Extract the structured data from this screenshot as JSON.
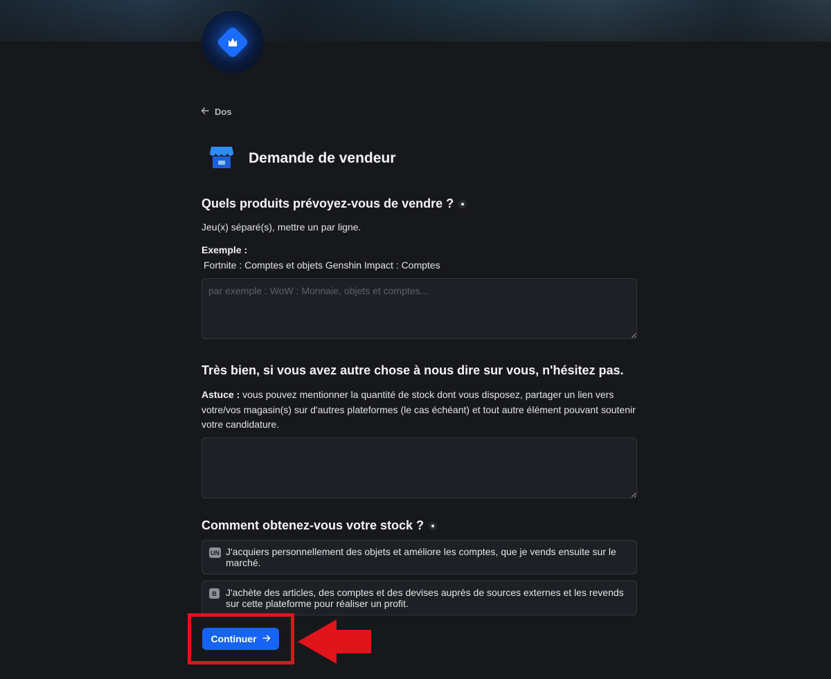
{
  "nav": {
    "back_label": "Dos"
  },
  "page": {
    "title": "Demande de vendeur"
  },
  "products": {
    "question": "Quels produits prévoyez-vous de vendre ?",
    "hint": "Jeu(x) séparé(s), mettre un par ligne.",
    "example_label": "Exemple :",
    "example_text": "Fortnite : Comptes et objets Genshin Impact : Comptes",
    "placeholder": "par exemple : WoW : Monnaie, objets et comptes..."
  },
  "about": {
    "question": "Très bien, si vous avez autre chose à nous dire sur vous, n'hésitez pas.",
    "tip_label": "Astuce :",
    "tip_text": " vous pouvez mentionner la quantité de stock dont vous disposez, partager un lien vers votre/vos magasin(s) sur d'autres plateformes (le cas échéant) et tout autre élément pouvant soutenir votre candidature.",
    "placeholder": ""
  },
  "stock": {
    "question": "Comment obtenez-vous votre stock ?",
    "options": [
      {
        "key": "UN",
        "label": "J'acquiers personnellement des objets et améliore les comptes, que je vends ensuite sur le marché."
      },
      {
        "key": "B",
        "label": "J'achète des articles, des comptes et des devises auprès de sources externes et les revends sur cette plateforme pour réaliser un profit."
      }
    ]
  },
  "actions": {
    "continue_label": "Continuer"
  },
  "colors": {
    "background": "#17181c",
    "accent": "#1763f5",
    "highlight": "#e0141b"
  },
  "icons": [
    "back-arrow-icon",
    "store-icon",
    "required-dot-icon",
    "arrow-right-icon",
    "logo-icon"
  ]
}
